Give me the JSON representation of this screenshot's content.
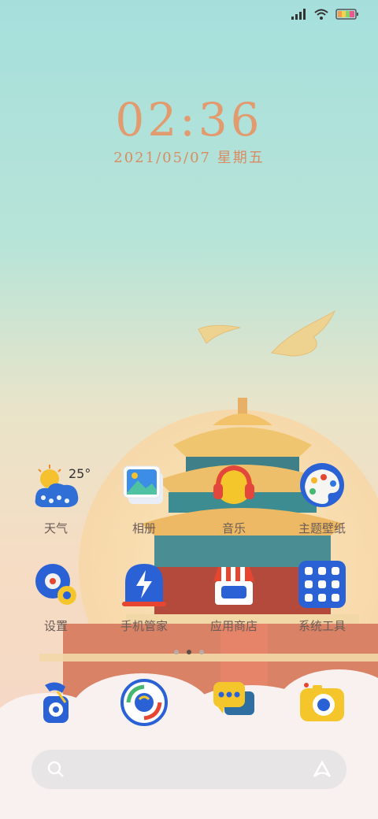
{
  "status_bar": {
    "signal_icon": "signal-bars-icon",
    "wifi_icon": "wifi-icon",
    "battery_icon": "battery-icon"
  },
  "lock": {
    "time": "02:36",
    "date": "2021/05/07 星期五"
  },
  "apps_row1": [
    {
      "label": "天气",
      "icon": "weather-icon",
      "extra": "25°"
    },
    {
      "label": "相册",
      "icon": "gallery-icon"
    },
    {
      "label": "音乐",
      "icon": "music-icon"
    },
    {
      "label": "主题壁纸",
      "icon": "themes-icon"
    }
  ],
  "apps_row2": [
    {
      "label": "设置",
      "icon": "settings-icon"
    },
    {
      "label": "手机管家",
      "icon": "phone-manager-icon"
    },
    {
      "label": "应用商店",
      "icon": "app-store-icon"
    },
    {
      "label": "系统工具",
      "icon": "system-tools-icon"
    }
  ],
  "page_indicator": {
    "count": 3,
    "active": 2
  },
  "dock": [
    {
      "icon": "phone-icon"
    },
    {
      "icon": "browser-icon"
    },
    {
      "icon": "messages-icon"
    },
    {
      "icon": "camera-icon"
    }
  ],
  "search": {
    "left_icon": "search-icon",
    "right_icon": "assistant-icon"
  }
}
